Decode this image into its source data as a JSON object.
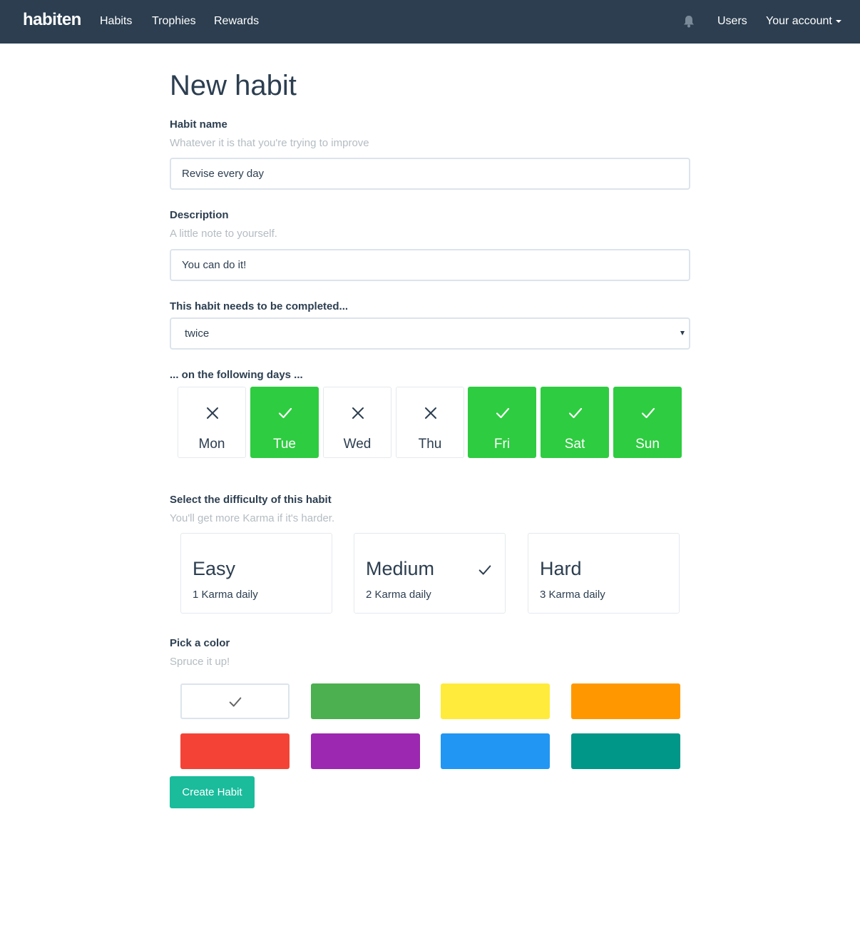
{
  "navbar": {
    "brand": "habiten",
    "links": [
      "Habits",
      "Trophies",
      "Rewards"
    ],
    "users": "Users",
    "account": "Your account",
    "bg_color": "#2c3e50"
  },
  "page": {
    "title": "New habit"
  },
  "habit_name": {
    "label": "Habit name",
    "help": "Whatever it is that you're trying to improve",
    "value": "Revise every day"
  },
  "description": {
    "label": "Description",
    "help": "A little note to yourself.",
    "value": "You can do it!"
  },
  "frequency": {
    "label": "This habit needs to be completed...",
    "selected": "twice"
  },
  "days": {
    "label": "... on the following days ...",
    "items": [
      {
        "name": "Mon",
        "selected": false
      },
      {
        "name": "Tue",
        "selected": true
      },
      {
        "name": "Wed",
        "selected": false
      },
      {
        "name": "Thu",
        "selected": false
      },
      {
        "name": "Fri",
        "selected": true
      },
      {
        "name": "Sat",
        "selected": true
      },
      {
        "name": "Sun",
        "selected": true
      }
    ],
    "selected_color": "#2ecc40"
  },
  "difficulty": {
    "label": "Select the difficulty of this habit",
    "help": "You'll get more Karma if it's harder.",
    "options": [
      {
        "name": "Easy",
        "karma": "1 Karma daily",
        "selected": false
      },
      {
        "name": "Medium",
        "karma": "2 Karma daily",
        "selected": true
      },
      {
        "name": "Hard",
        "karma": "3 Karma daily",
        "selected": false
      }
    ]
  },
  "color": {
    "label": "Pick a color",
    "help": "Spruce it up!",
    "swatches": [
      "#ffffff",
      "#4caf50",
      "#ffeb3b",
      "#ff9800",
      "#f44336",
      "#9c27b0",
      "#2196f3",
      "#009688"
    ],
    "selected_index": 0
  },
  "submit": {
    "label": "Create Habit",
    "color": "#1abc9c"
  }
}
